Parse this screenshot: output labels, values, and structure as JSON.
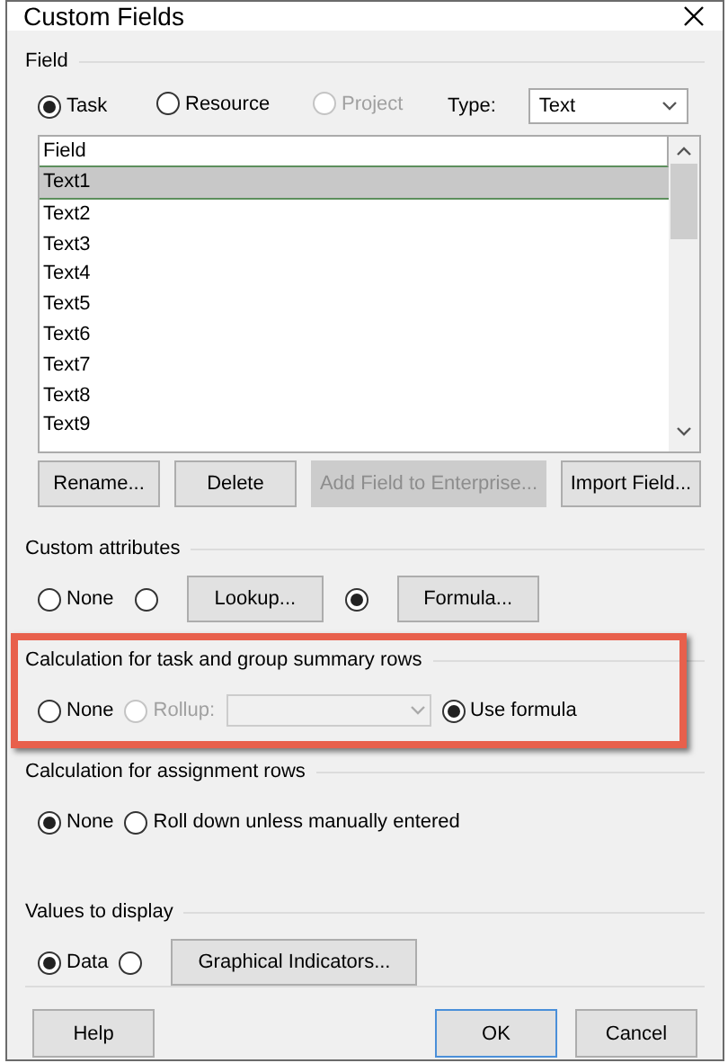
{
  "window": {
    "title": "Custom Fields"
  },
  "field": {
    "title": "Field",
    "scopes": [
      {
        "label": "Task",
        "selected": true,
        "disabled": false
      },
      {
        "label": "Resource",
        "selected": false,
        "disabled": false
      },
      {
        "label": "Project",
        "selected": false,
        "disabled": true
      }
    ],
    "type_label": "Type:",
    "type_value": "Text",
    "list_header": "Field",
    "rows": [
      {
        "label": "Text1",
        "selected": true
      },
      {
        "label": "Text2",
        "selected": false
      },
      {
        "label": "Text3",
        "selected": false
      },
      {
        "label": "Text4",
        "selected": false
      },
      {
        "label": "Text5",
        "selected": false
      },
      {
        "label": "Text6",
        "selected": false
      },
      {
        "label": "Text7",
        "selected": false
      },
      {
        "label": "Text8",
        "selected": false
      },
      {
        "label": "Text9",
        "selected": false
      }
    ],
    "buttons": [
      {
        "label": "Rename...",
        "disabled": false
      },
      {
        "label": "Delete",
        "disabled": false
      },
      {
        "label": "Add Field to Enterprise...",
        "disabled": true
      },
      {
        "label": "Import Field...",
        "disabled": false
      }
    ]
  },
  "sections": [
    {
      "title": "Custom attributes",
      "highlighted": false,
      "options": [
        {
          "kind": "radio",
          "label": "None",
          "selected": false,
          "disabled": false
        },
        {
          "kind": "radio_button",
          "button": "Lookup...",
          "selected": false,
          "disabled": false
        },
        {
          "kind": "radio_button",
          "button": "Formula...",
          "selected": true,
          "disabled": false
        }
      ]
    },
    {
      "title": "Calculation for task and group summary rows",
      "highlighted": true,
      "options": [
        {
          "kind": "radio",
          "label": "None",
          "selected": false,
          "disabled": false
        },
        {
          "kind": "radio",
          "label": "Rollup:",
          "selected": false,
          "disabled": true
        },
        {
          "kind": "dropdown",
          "disabled": true
        },
        {
          "kind": "radio",
          "label": "Use formula",
          "selected": true,
          "disabled": false
        }
      ]
    },
    {
      "title": "Calculation for assignment rows",
      "highlighted": false,
      "options": [
        {
          "kind": "radio",
          "label": "None",
          "selected": true,
          "disabled": false
        },
        {
          "kind": "radio",
          "label": "Roll down unless manually entered",
          "selected": false,
          "disabled": false
        }
      ]
    },
    {
      "title": "Values to display",
      "highlighted": false,
      "options": [
        {
          "kind": "radio",
          "label": "Data",
          "selected": true,
          "disabled": false
        },
        {
          "kind": "radio_button",
          "button": "Graphical Indicators...",
          "selected": false,
          "disabled": false
        }
      ]
    }
  ],
  "footer": [
    {
      "label": "Help",
      "default": false
    },
    {
      "label": "OK",
      "default": true
    },
    {
      "label": "Cancel",
      "default": false
    }
  ]
}
